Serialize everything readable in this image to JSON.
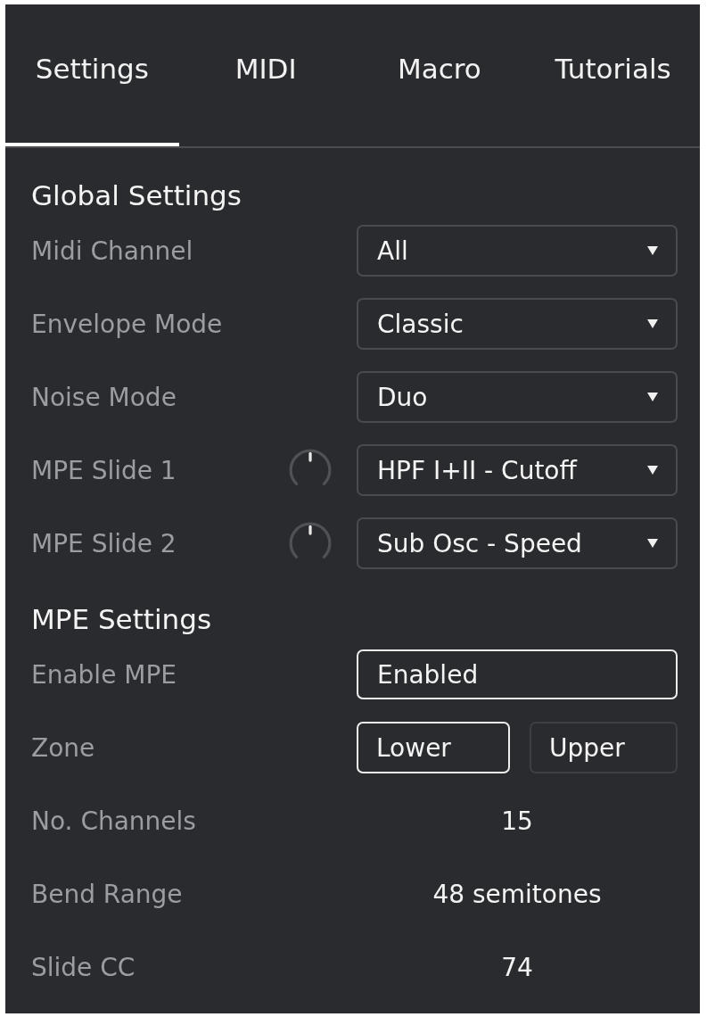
{
  "tabs": [
    {
      "label": "Settings",
      "selected": true
    },
    {
      "label": "MIDI",
      "selected": false
    },
    {
      "label": "Macro",
      "selected": false
    },
    {
      "label": "Tutorials",
      "selected": false
    }
  ],
  "sections": [
    {
      "title": "Global Settings",
      "rows": [
        {
          "kind": "dropdown",
          "label": "Midi Channel",
          "value": "All"
        },
        {
          "kind": "dropdown",
          "label": "Envelope Mode",
          "value": "Classic"
        },
        {
          "kind": "dropdown",
          "label": "Noise Mode",
          "value": "Duo"
        },
        {
          "kind": "dropdown",
          "label": "MPE Slide 1",
          "value": "HPF I+II - Cutoff",
          "knob": {
            "level": 0.5
          }
        },
        {
          "kind": "dropdown",
          "label": "MPE Slide 2",
          "value": "Sub Osc - Speed",
          "knob": {
            "level": 0.5
          }
        }
      ]
    },
    {
      "title": "MPE Settings",
      "rows": [
        {
          "kind": "toggle",
          "label": "Enable MPE",
          "value": "Enabled",
          "on": true
        },
        {
          "kind": "segmented",
          "label": "Zone",
          "options": [
            {
              "label": "Lower",
              "selected": true
            },
            {
              "label": "Upper",
              "selected": false
            }
          ]
        },
        {
          "kind": "value",
          "label": "No. Channels",
          "value": "15"
        },
        {
          "kind": "value",
          "label": "Bend Range",
          "value": "48 semitones"
        },
        {
          "kind": "value",
          "label": "Slide CC",
          "value": "74"
        }
      ]
    }
  ]
}
